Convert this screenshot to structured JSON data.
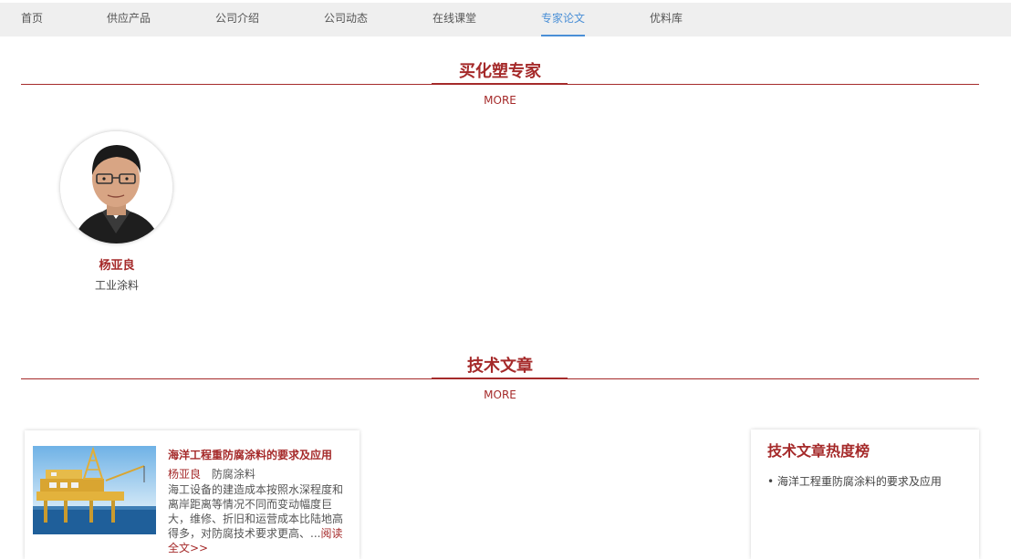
{
  "nav": {
    "items": [
      {
        "label": "首页"
      },
      {
        "label": "供应产品"
      },
      {
        "label": "公司介绍"
      },
      {
        "label": "公司动态"
      },
      {
        "label": "在线课堂"
      },
      {
        "label": "专家论文",
        "active": true
      },
      {
        "label": "优料库"
      }
    ],
    "active_color": "#4a8fd6"
  },
  "experts_section": {
    "title": "买化塑专家",
    "more": "MORE",
    "experts": [
      {
        "name": "杨亚良",
        "field": "工业涂料"
      }
    ]
  },
  "articles_section": {
    "title": "技术文章",
    "more": "MORE",
    "articles": [
      {
        "title": "海洋工程重防腐涂料的要求及应用",
        "author": "杨亚良",
        "category": "防腐涂料",
        "summary": "海工设备的建造成本按照水深程度和离岸距离等情况不同而变动幅度巨大，维修、折旧和运营成本比陆地高得多，对防腐技术要求更高、...",
        "read_more": "阅读全文>>"
      }
    ]
  },
  "hot_list": {
    "title": "技术文章热度榜",
    "items": [
      {
        "label": "海洋工程重防腐涂料的要求及应用"
      }
    ]
  },
  "colors": {
    "accent": "#a52a2a",
    "nav_bg": "#efefef"
  }
}
